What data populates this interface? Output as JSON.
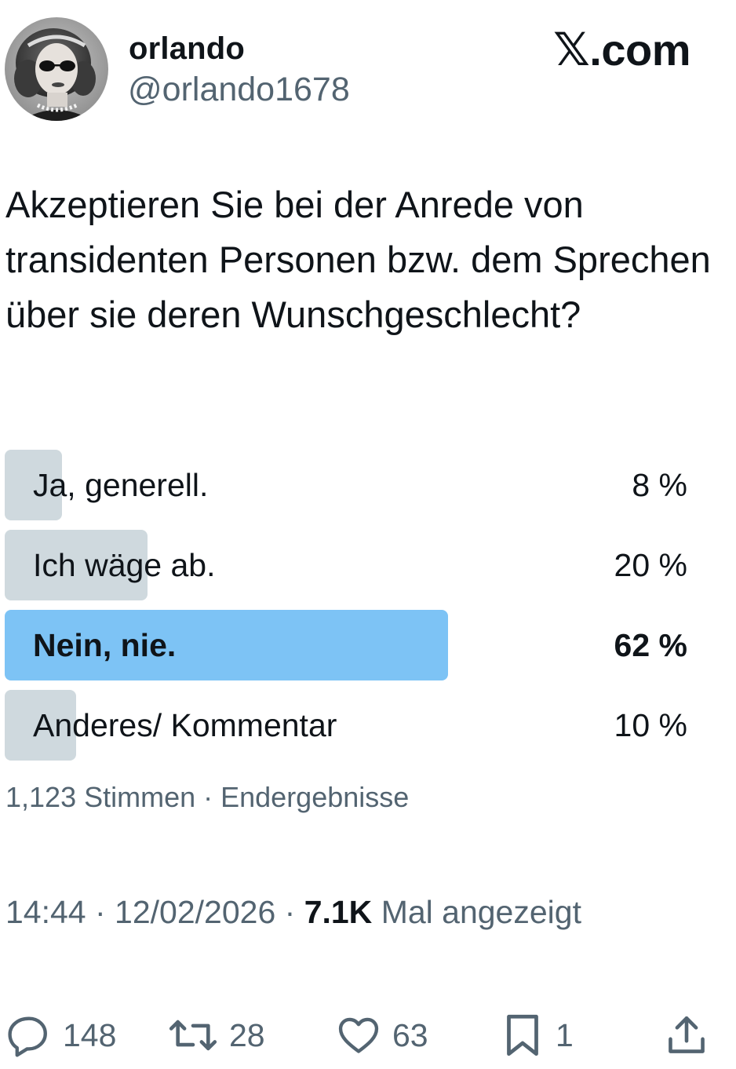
{
  "author": {
    "display_name": "orlando",
    "handle": "@orlando1678"
  },
  "brand": {
    "x_glyph": "𝕏",
    "domain": ".com"
  },
  "tweet": {
    "text": "Akzeptieren Sie bei der Anrede von transidenten Personen bzw. dem Sprechen über sie deren Wunschgeschlecht?"
  },
  "poll": {
    "options": [
      {
        "label": "Ja, generell.",
        "percent_text": "8 %",
        "percent": 8
      },
      {
        "label": "Ich wäge ab.",
        "percent_text": "20 %",
        "percent": 20
      },
      {
        "label": "Nein, nie.",
        "percent_text": "62 %",
        "percent": 62,
        "winner": true
      },
      {
        "label": "Anderes/ Kommentar",
        "percent_text": "10 %",
        "percent": 10
      }
    ],
    "meta": "1,123 Stimmen · Endergebnisse",
    "colors": {
      "bar": "#cfd9de",
      "winner_bar": "#7dc3f5"
    }
  },
  "timestamp": {
    "time": "14:44",
    "separator": " · ",
    "date": "12/02/2026",
    "views": "7.1K",
    "views_suffix": " Mal angezeigt"
  },
  "actions": {
    "replies": {
      "icon": "reply-icon",
      "count": "148"
    },
    "reposts": {
      "icon": "repost-icon",
      "count": "28"
    },
    "likes": {
      "icon": "heart-icon",
      "count": "63"
    },
    "bookmarks": {
      "icon": "bookmark-icon",
      "count": "1"
    },
    "share": {
      "icon": "share-icon"
    }
  }
}
